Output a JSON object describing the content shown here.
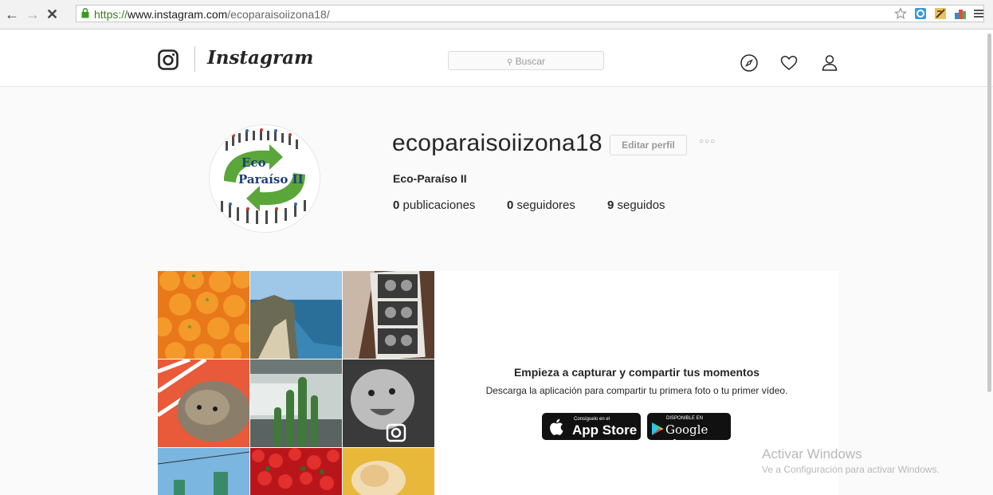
{
  "browser": {
    "url_scheme": "https://",
    "url_host": "www.instagram.com",
    "url_path": "/ecoparaisoiizona18/"
  },
  "header": {
    "wordmark": "Instagram",
    "search_placeholder": "Buscar"
  },
  "profile": {
    "username": "ecoparaisoiizona18",
    "edit_button": "Editar perfil",
    "more": "○○○",
    "full_name": "Eco-Paraíso II",
    "avatar_text": [
      "Eco",
      "Paraíso II"
    ],
    "stats": [
      {
        "count": "0",
        "label": "publicaciones"
      },
      {
        "count": "0",
        "label": "seguidores"
      },
      {
        "count": "9",
        "label": "seguidos"
      }
    ]
  },
  "promo": {
    "title": "Empieza a capturar y compartir tus momentos",
    "subtitle": "Descarga la aplicación para compartir tu primera foto o tu primer vídeo.",
    "app_store_top": "Consíguelo en el",
    "app_store_main": "App Store",
    "google_play_top": "DISPONIBLE EN",
    "google_play_main": "Google play"
  },
  "watermark": {
    "line1": "Activar Windows",
    "line2": "Ve a Configuración para activar Windows."
  }
}
